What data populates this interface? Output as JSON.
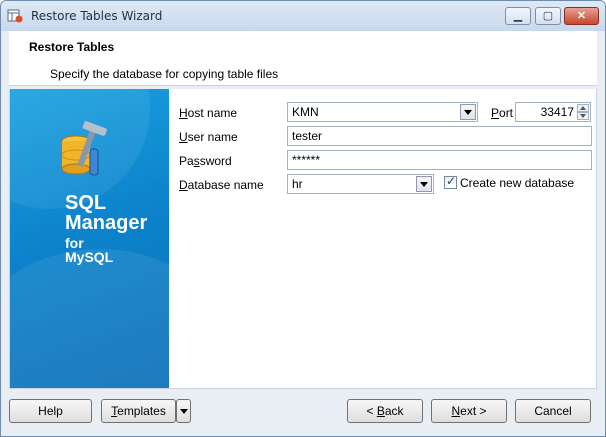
{
  "window": {
    "title": "Restore Tables Wizard"
  },
  "header": {
    "title": "Restore Tables",
    "subtitle": "Specify the database for copying table files"
  },
  "brand": {
    "line1": "SQL",
    "line2": "Manager",
    "line3": "for",
    "line4": "MySQL"
  },
  "form": {
    "host_label_u": "H",
    "host_label_rest": "ost name",
    "host_value": "KMN",
    "port_label_u": "P",
    "port_label_rest": "ort",
    "port_value": "33417",
    "user_label_u": "U",
    "user_label_rest": "ser name",
    "user_value": "tester",
    "password_label_pre": "Pa",
    "password_label_u": "s",
    "password_label_rest": "sword",
    "password_value": "******",
    "database_label_u": "D",
    "database_label_rest": "atabase name",
    "database_value": "hr",
    "create_db_label": "Create new database",
    "create_db_checked": true
  },
  "buttons": {
    "help": "Help",
    "templates_u": "T",
    "templates_rest": "emplates",
    "back": "< Back",
    "back_u": "B",
    "next_u": "N",
    "next_rest": "ext >",
    "cancel": "Cancel"
  }
}
